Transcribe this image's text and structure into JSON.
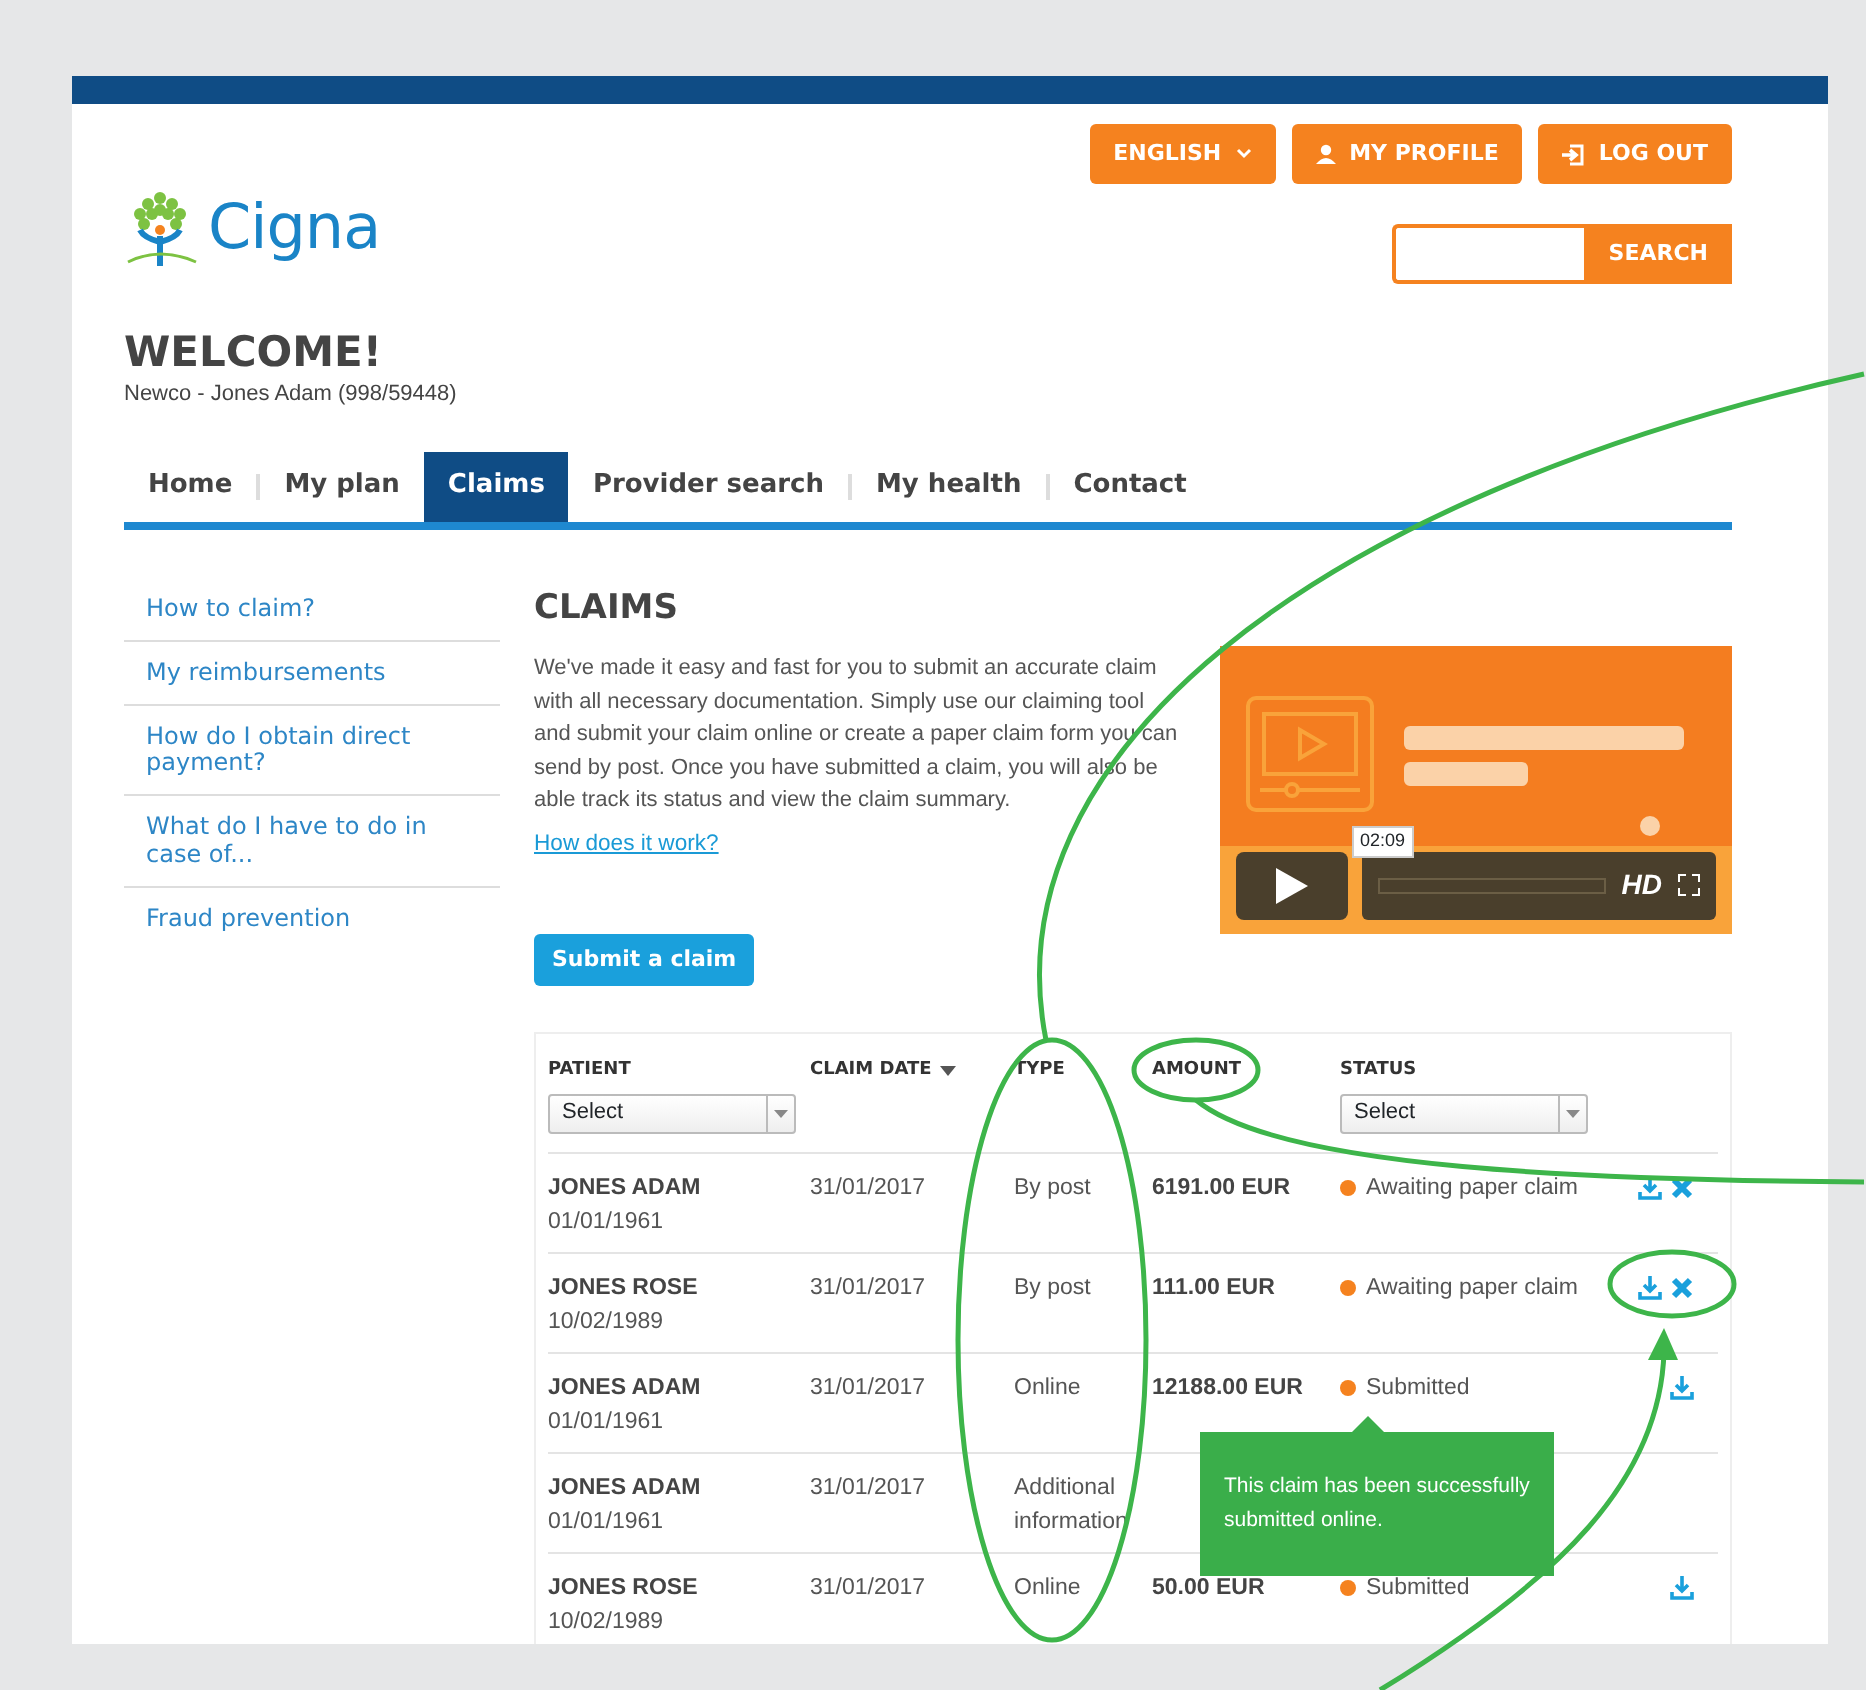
{
  "header": {
    "logo": "Cigna",
    "language_button": "ENGLISH",
    "profile_button": "MY PROFILE",
    "logout_button": "LOG OUT",
    "search_button": "SEARCH"
  },
  "welcome": {
    "title": "WELCOME!",
    "subtitle": "Newco - Jones Adam (998/59448)"
  },
  "nav": [
    {
      "label": "Home",
      "selected": false
    },
    {
      "label": "My plan",
      "selected": false
    },
    {
      "label": "Claims",
      "selected": true
    },
    {
      "label": "Provider search",
      "selected": false
    },
    {
      "label": "My health",
      "selected": false
    },
    {
      "label": "Contact",
      "selected": false
    }
  ],
  "sidebar": {
    "items": [
      "How to claim?",
      "My reimbursements",
      "How do I obtain direct payment?",
      "What do I have to do in case of...",
      "Fraud prevention"
    ]
  },
  "main": {
    "title": "CLAIMS",
    "intro": "We've made it easy and fast for you to submit an accurate claim with all necessary documentation. Simply use our claiming tool and submit your claim online or create a paper claim form you can send by post. Once you have submitted a claim, you will also be able track its status and view the claim summary.",
    "link": "How does it work?",
    "submit_button": "Submit a claim"
  },
  "video": {
    "kind": "picture",
    "time": "02:09",
    "quality": "HD"
  },
  "table": {
    "columns": [
      {
        "label": "PATIENT",
        "filter": "Select"
      },
      {
        "label": "CLAIM DATE",
        "sorted": true
      },
      {
        "label": "TYPE"
      },
      {
        "label": "AMOUNT"
      },
      {
        "label": "STATUS",
        "filter": "Select"
      }
    ],
    "rows": [
      {
        "patient": "JONES ADAM",
        "birth_date": "01/01/1961",
        "claim_date": "31/01/2017",
        "type": "By post",
        "amount": "6191.00 EUR",
        "status": "Awaiting paper claim",
        "downloadable": true,
        "deletable": true,
        "tooltip": false
      },
      {
        "patient": "JONES ROSE",
        "birth_date": "10/02/1989",
        "claim_date": "31/01/2017",
        "type": "By post",
        "amount": "111.00 EUR",
        "status": "Awaiting paper claim",
        "downloadable": true,
        "deletable": true,
        "tooltip": false
      },
      {
        "patient": "JONES ADAM",
        "birth_date": "01/01/1961",
        "claim_date": "31/01/2017",
        "type": "Online",
        "amount": "12188.00 EUR",
        "status": "Submitted",
        "downloadable": true,
        "deletable": false,
        "tooltip": true
      },
      {
        "patient": "JONES ADAM",
        "birth_date": "01/01/1961",
        "claim_date": "31/01/2017",
        "type": "Additional information",
        "downloadable": false,
        "deletable": false,
        "tooltip": false
      },
      {
        "patient": "JONES ROSE",
        "birth_date": "10/02/1989",
        "claim_date": "31/01/2017",
        "type": "Online",
        "amount": "50.00 EUR",
        "status": "Submitted",
        "downloadable": true,
        "deletable": false,
        "tooltip": false
      }
    ]
  },
  "tooltip": {
    "text": "This claim has been successfully submitted online."
  }
}
